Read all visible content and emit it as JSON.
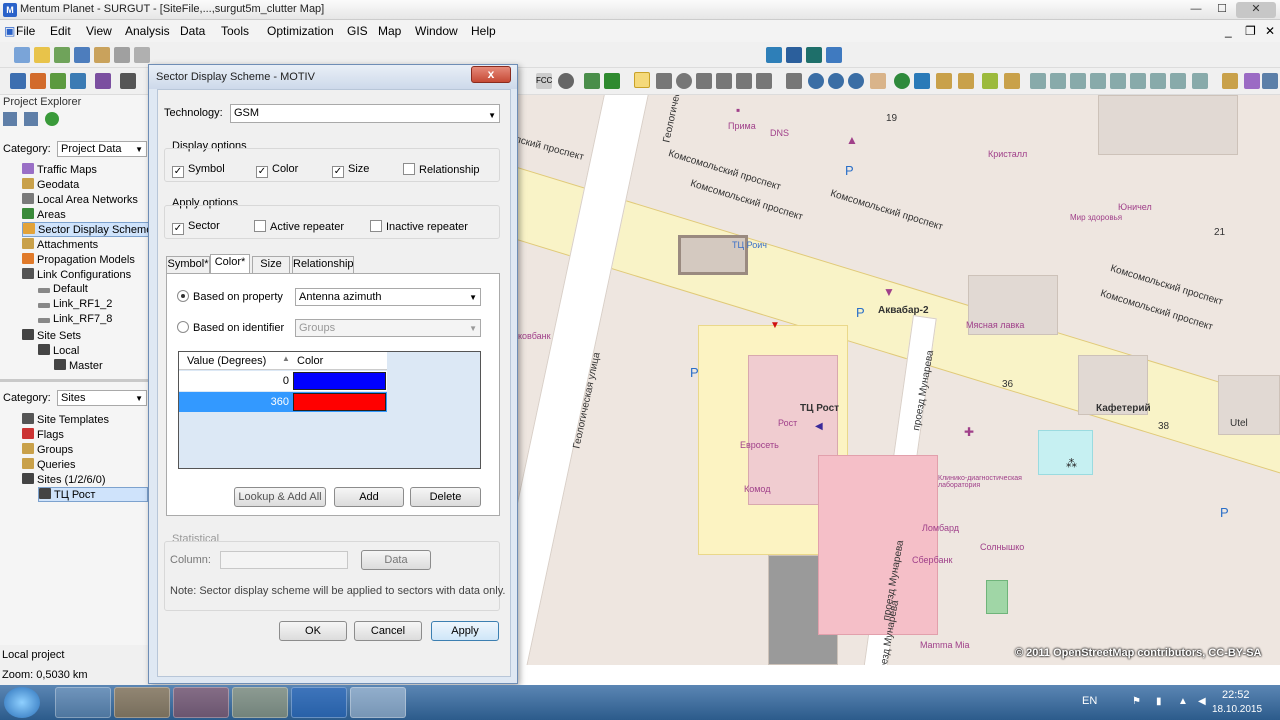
{
  "window": {
    "title": "Mentum Planet - SURGUT - [SiteFile,...,surgut5m_clutter Map]"
  },
  "menu": [
    "File",
    "Edit",
    "View",
    "Analysis",
    "Data",
    "Tools",
    "Optimization",
    "GIS",
    "Map",
    "Window",
    "Help"
  ],
  "project_explorer": {
    "title": "Project Explorer",
    "category_label": "Category:",
    "category_value": "Project Data",
    "tree": [
      "Traffic Maps",
      "Geodata",
      "Local Area Networks",
      "Areas",
      "Sector Display Schemes",
      "Attachments",
      "Propagation Models",
      "Link Configurations",
      "Default",
      "Link_RF1_2",
      "Link_RF7_8",
      "Site Sets",
      "Local",
      "Master"
    ],
    "category2_value": "Sites",
    "tree2": [
      "Site Templates",
      "Flags",
      "Groups",
      "Queries",
      "Sites (1/2/6/0)",
      "ТЦ Рост"
    ],
    "status_project": "Local project",
    "status_zoom": "Zoom: 0,5030 km"
  },
  "dialog": {
    "title": "Sector Display Scheme - MOTIV",
    "close": "x",
    "technology_label": "Technology:",
    "technology_value": "GSM",
    "display_options_label": "Display options",
    "display_options": [
      {
        "label": "Symbol",
        "checked": true
      },
      {
        "label": "Color",
        "checked": true
      },
      {
        "label": "Size",
        "checked": true
      },
      {
        "label": "Relationship",
        "checked": false
      }
    ],
    "apply_options_label": "Apply options",
    "apply_options": [
      {
        "label": "Sector",
        "checked": true
      },
      {
        "label": "Active repeater",
        "checked": false
      },
      {
        "label": "Inactive repeater",
        "checked": false
      }
    ],
    "tabs": [
      "Symbol*",
      "Color*",
      "Size",
      "Relationship"
    ],
    "based_on_property_label": "Based on property",
    "based_on_property_value": "Antenna azimuth",
    "based_on_identifier_label": "Based on identifier",
    "based_on_identifier_value": "Groups",
    "table_headers": [
      "Value (Degrees)",
      "Color"
    ],
    "table_rows": [
      {
        "value": "0",
        "color": "#0000ff"
      },
      {
        "value": "360",
        "color": "#ff0000"
      }
    ],
    "btn_lookup": "Lookup & Add All",
    "btn_add": "Add",
    "btn_delete": "Delete",
    "statistical_label": "Statistical",
    "column_label": "Column:",
    "btn_data": "Data",
    "note": "Note: Sector display scheme will be applied to sectors with data only.",
    "btn_ok": "OK",
    "btn_cancel": "Cancel",
    "btn_apply": "Apply"
  },
  "map": {
    "labels": [
      "Комсомольский проспект",
      "Комсомольский проспект",
      "Комсомольский проспект",
      "Комсомольский проспект",
      "лский проспект",
      "Геологическая улица",
      "Геологическая улица",
      "проезд Мунарева",
      "проезд Мунарева",
      "проезд Мунарева",
      "ТЦ Рост",
      "Аквабар-2",
      "Кафетерий",
      "Мясная лавка",
      "Кристалл",
      "Юничел",
      "Мир здоровья",
      "DNS",
      "Прима",
      "Евросеть",
      "Комод",
      "Рост",
      "Ломбард",
      "Сбербанк",
      "Солнышко",
      "Mamma Mia",
      "Utel",
      "19",
      "21",
      "36",
      "38",
      "ТЦ Роич",
      "Клинико-диагностическая лаборатория",
      "ковбанк"
    ],
    "attribution": "© 2011 OpenStreetMap contributors, CC-BY-SA"
  },
  "taskbar": {
    "lang": "EN",
    "time": "22:52",
    "date": "18.10.2015"
  }
}
